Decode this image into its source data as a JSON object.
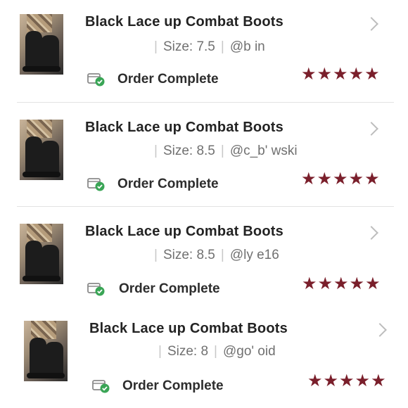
{
  "accent_color": "#7a1f2b",
  "orders": [
    {
      "title": "Black Lace up Combat Boots",
      "size": "Size: 7.5",
      "user": "@b        in",
      "status": "Order Complete",
      "rating": 5,
      "status_icon": "package-check-icon"
    },
    {
      "title": "Black Lace up Combat Boots",
      "size": "Size: 8.5",
      "user": "@c_b'      wski",
      "status": "Order Complete",
      "rating": 5,
      "status_icon": "package-check-icon"
    },
    {
      "title": "Black Lace up Combat Boots",
      "size": "Size: 8.5",
      "user": "@ly    e16",
      "status": "Order Complete",
      "rating": 5,
      "status_icon": "package-check-icon"
    },
    {
      "title": "Black Lace up Combat Boots",
      "size": "Size: 8",
      "user": "@go'    oid",
      "status": "Order Complete",
      "rating": 5,
      "status_icon": "package-check-icon"
    }
  ]
}
